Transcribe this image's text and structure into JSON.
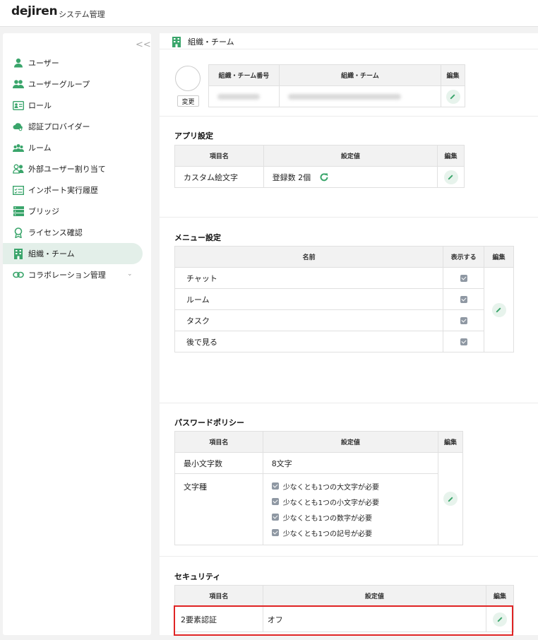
{
  "header": {
    "logo": "dejiren",
    "title": "システム管理"
  },
  "sidebar": {
    "collapse_label": "<<",
    "items": [
      {
        "label": "ユーザー",
        "icon": "user-icon"
      },
      {
        "label": "ユーザーグループ",
        "icon": "users-icon"
      },
      {
        "label": "ロール",
        "icon": "id-card-icon"
      },
      {
        "label": "認証プロバイダー",
        "icon": "cloud-key-icon"
      },
      {
        "label": "ルーム",
        "icon": "group-icon"
      },
      {
        "label": "外部ユーザー割り当て",
        "icon": "external-user-icon"
      },
      {
        "label": "インポート実行履歴",
        "icon": "checklist-icon"
      },
      {
        "label": "ブリッジ",
        "icon": "server-icon"
      },
      {
        "label": "ライセンス確認",
        "icon": "badge-icon"
      },
      {
        "label": "組織・チーム",
        "icon": "building-icon",
        "active": true
      },
      {
        "label": "コラボレーション管理",
        "icon": "link-icon",
        "chevron": "⌄"
      }
    ]
  },
  "page": {
    "title": "組織・チーム"
  },
  "org": {
    "change_label": "変更",
    "headers": [
      "組織・チーム番号",
      "組織・チーム",
      "編集"
    ]
  },
  "app_settings": {
    "title": "アプリ設定",
    "headers": [
      "項目名",
      "設定値",
      "編集"
    ],
    "rows": [
      {
        "name": "カスタム絵文字",
        "value": "登録数 2個"
      }
    ]
  },
  "menu_settings": {
    "title": "メニュー設定",
    "headers": [
      "名前",
      "表示する",
      "編集"
    ],
    "rows": [
      "チャット",
      "ルーム",
      "タスク",
      "後で見る"
    ]
  },
  "password_policy": {
    "title": "パスワードポリシー",
    "headers": [
      "項目名",
      "設定値",
      "編集"
    ],
    "min_length_label": "最小文字数",
    "min_length_value": "8文字",
    "char_types_label": "文字種",
    "char_rules": [
      "少なくとも1つの大文字が必要",
      "少なくとも1つの小文字が必要",
      "少なくとも1つの数字が必要",
      "少なくとも1つの記号が必要"
    ]
  },
  "security": {
    "title": "セキュリティ",
    "headers": [
      "項目名",
      "設定値",
      "編集"
    ],
    "rows": [
      {
        "name": "2要素認証",
        "value": "オフ"
      }
    ]
  },
  "colors": {
    "accent": "#3aa56b",
    "highlight": "#e02424",
    "active_bg": "#e3efe9"
  }
}
